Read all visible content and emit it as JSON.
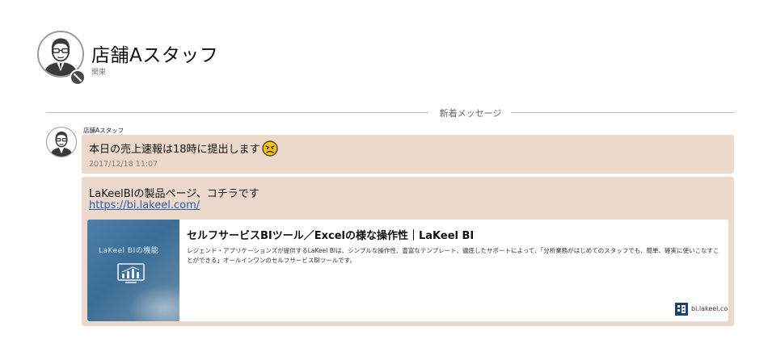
{
  "header": {
    "name": "店舗Aスタッフ",
    "region": "関東",
    "avatar_icon": "person-avatar-icon",
    "badge_icon": "no-entry-badge-icon"
  },
  "divider": {
    "label": "新着メッセージ"
  },
  "messages": [
    {
      "sender": "店舗Aスタッフ",
      "text": "本日の売上速報は18時に提出します",
      "emoji_icon": "worried-face-emoji-icon",
      "time": "2017/12/18 11:07"
    },
    {
      "text": "LaKeelBIの製品ページ、コチラです",
      "link": "https://bi.lakeel.com/",
      "preview": {
        "title": "セルフサービスBIツール／Excelの様な操作性｜LaKeel BI",
        "description": "レジェンド・アプリケーションズが提供するLaKeel BIは、シンプルな操作性、豊富なテンプレート、徹底したサポートによって、「分析業務がはじめてのスタッフでも、簡単、確実に使いこなすことができる」オールインワンのセルフサービスBIツールです。",
        "thumbnail_title": "LaKeel BIの機能",
        "domain": "bi.lakeel.com"
      }
    }
  ],
  "colors": {
    "bubble": "#ecd9cb",
    "link": "#2a5db0",
    "thumbnail": "#4f7fa8"
  }
}
